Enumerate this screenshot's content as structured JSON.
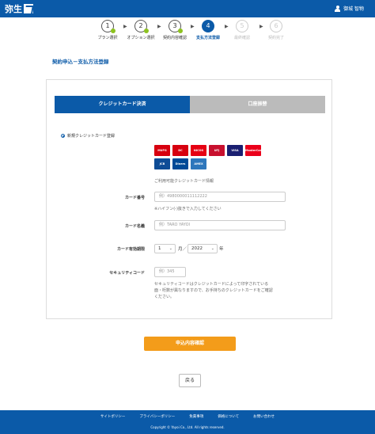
{
  "header": {
    "logo_text": "弥生",
    "user_name": "御城 智物"
  },
  "steps": [
    {
      "number": "1",
      "label": "プラン選択",
      "state": "done"
    },
    {
      "number": "2",
      "label": "オプション選択",
      "state": "done"
    },
    {
      "number": "3",
      "label": "契約内容確認",
      "state": "done"
    },
    {
      "number": "4",
      "label": "支払方法登録",
      "state": "active"
    },
    {
      "number": "5",
      "label": "最終確認",
      "state": "future"
    },
    {
      "number": "6",
      "label": "契約完了",
      "state": "future"
    }
  ],
  "page_title": "契約申込－支払方法登録",
  "tabs": {
    "credit": "クレジットカード決済",
    "bank": "口座振替"
  },
  "radio_label": "新規クレジットカード登録",
  "cards": {
    "row1": [
      {
        "name": "MUFG",
        "color": "#d7000f"
      },
      {
        "name": "DC",
        "color": "#d7000f"
      },
      {
        "name": "NICOS",
        "color": "#e60012"
      },
      {
        "name": "UFJ",
        "color": "#c8102e"
      },
      {
        "name": "VISA",
        "color": "#1a1f71"
      },
      {
        "name": "MasterCard",
        "color": "#eb001b"
      }
    ],
    "row2": [
      {
        "name": "JCB",
        "color": "#0e4c96"
      },
      {
        "name": "Diners Club",
        "color": "#004a97"
      },
      {
        "name": "AMEX",
        "color": "#2e77bc"
      }
    ]
  },
  "available_note": "ご利用可能クレジットカード情報",
  "form": {
    "card_number_label": "カード番号",
    "card_number_placeholder": "例）4980000011112222",
    "card_number_hint": "※ハイフン(-)抜きで入力してください",
    "card_name_label": "カード名義",
    "card_name_placeholder": "例）TARO YAYOI",
    "expiry_label": "カード有効期限",
    "expiry_month": "1",
    "month_unit": "月／",
    "expiry_year": "2022",
    "year_unit": "年",
    "security_label": "セキュリティコード",
    "security_placeholder": "例）345",
    "security_hint_1": "セキュリティコードはクレジットカードによって印字されている",
    "security_hint_2": "面・桁数が異なりますので、お手持ちのクレジットカードをご確認",
    "security_hint_3": "ください。"
  },
  "confirm_button": "申込内容確認",
  "back_button": "戻る",
  "footer": {
    "links": [
      "サイトポリシー",
      "プライバシーポリシー",
      "免責事項",
      "価格について",
      "お問い合わせ"
    ],
    "copyright": "Copyright © Yayoi Co., Ltd. All rights reserved."
  },
  "colors": {
    "brand": "#0b5aa8",
    "accent": "#f39c1a",
    "done": "#8dc21f"
  }
}
